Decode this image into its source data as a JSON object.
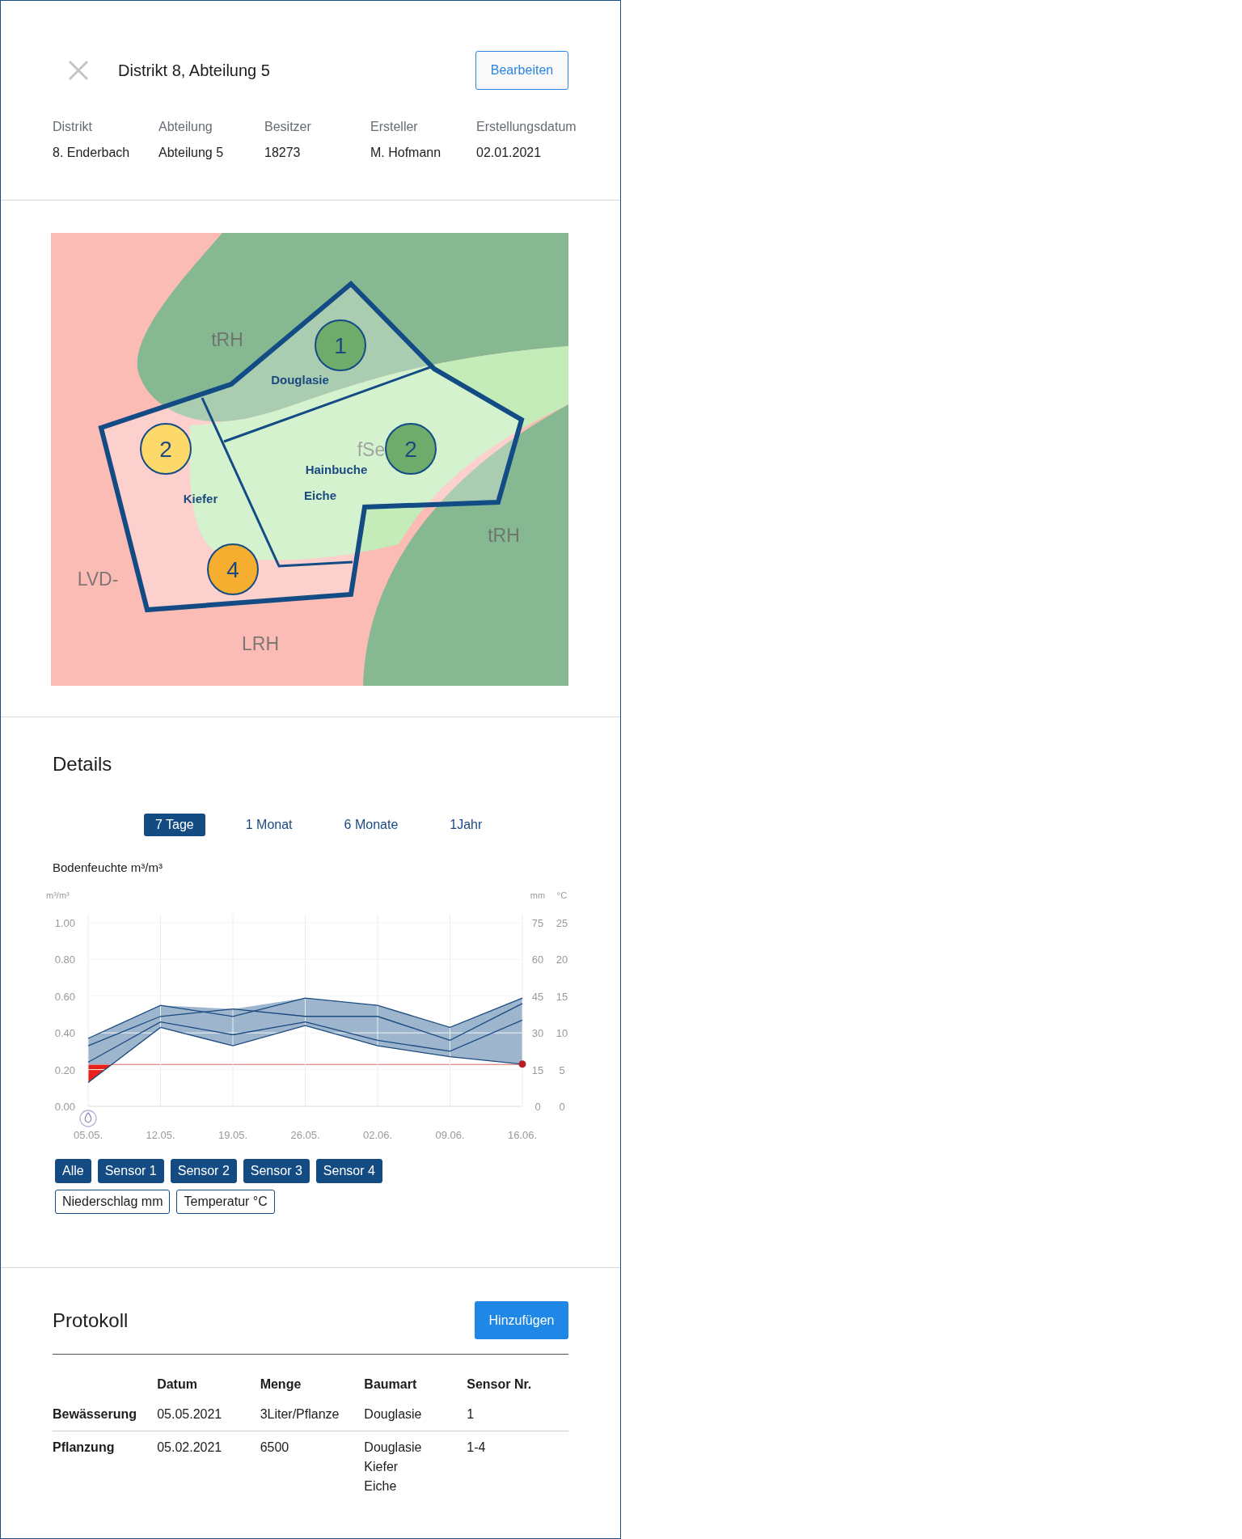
{
  "header": {
    "title": "Distrikt 8, Abteilung 5",
    "edit_button": "Bearbeiten"
  },
  "info": [
    {
      "label": "Distrikt",
      "value": "8. Enderbach"
    },
    {
      "label": "Abteilung",
      "value": "Abteilung 5"
    },
    {
      "label": "Besitzer",
      "value": "18273"
    },
    {
      "label": "Ersteller",
      "value": "M. Hofmann"
    },
    {
      "label": "Erstellungsdatum",
      "value": "02.01.2021"
    }
  ],
  "map": {
    "zone_labels": [
      "tRH",
      "fSe",
      "tRH",
      "LVD-",
      "LRH"
    ],
    "stand_labels": [
      "Douglasie",
      "Hainbuche",
      "Eiche",
      "Kiefer"
    ],
    "markers": [
      {
        "number": "1",
        "color": "#6fab6b"
      },
      {
        "number": "2",
        "color": "#fdd86b"
      },
      {
        "number": "2",
        "color": "#6fab6b"
      },
      {
        "number": "4",
        "color": "#f5ae30"
      }
    ]
  },
  "details": {
    "title": "Details",
    "ranges": [
      {
        "label": "7 Tage",
        "selected": true
      },
      {
        "label": "1 Monat",
        "selected": false
      },
      {
        "label": "6 Monate",
        "selected": false
      },
      {
        "label": "1Jahr",
        "selected": false
      }
    ],
    "chart_title": "Bodenfeuchte m³/m³",
    "right_axes": [
      {
        "unit": "mm",
        "ticks": [
          "75",
          "60",
          "45",
          "30",
          "15",
          "0"
        ]
      },
      {
        "unit": "°C",
        "ticks": [
          "25",
          "20",
          "15",
          "10",
          "5",
          "0"
        ]
      }
    ],
    "chart_data": {
      "type": "line",
      "ylabel": "m³/m³",
      "categories": [
        "05.05.",
        "12.05.",
        "19.05.",
        "26.05.",
        "02.06.",
        "09.06.",
        "16.06."
      ],
      "series": [
        {
          "color": "#1b4a80",
          "values": [
            0.37,
            0.55,
            0.49,
            0.59,
            0.55,
            0.43,
            0.59
          ]
        },
        {
          "color": "#1b4a80",
          "values": [
            0.33,
            0.49,
            0.53,
            0.49,
            0.49,
            0.36,
            0.56
          ]
        },
        {
          "color": "#1b4a80",
          "values": [
            0.24,
            0.46,
            0.39,
            0.46,
            0.36,
            0.3,
            0.47
          ]
        },
        {
          "color": "#1b4a80",
          "values": [
            0.13,
            0.43,
            0.33,
            0.44,
            0.33,
            0.27,
            0.23
          ]
        }
      ],
      "grid": true,
      "ylim": [
        0,
        1
      ],
      "yticks": [
        {
          "value": 1,
          "label": "1.00"
        },
        {
          "value": 0.8,
          "label": "0.80"
        },
        {
          "value": 0.6,
          "label": "0.60"
        },
        {
          "value": 0.4,
          "label": "0.40"
        },
        {
          "value": 0.2,
          "label": "0.20"
        },
        {
          "value": 0,
          "label": "0.00"
        }
      ]
    },
    "sensor_filters": [
      {
        "label": "Alle",
        "selected": true
      },
      {
        "label": "Sensor 1",
        "selected": true
      },
      {
        "label": "Sensor 2",
        "selected": true
      },
      {
        "label": "Sensor 3",
        "selected": true
      },
      {
        "label": "Sensor 4",
        "selected": true
      }
    ],
    "layer_toggles": [
      {
        "label": "Niederschlag mm",
        "selected": false
      },
      {
        "label": "Temperatur °C",
        "selected": false
      }
    ]
  },
  "protocol": {
    "title": "Protokoll",
    "add_button": "Hinzufügen",
    "columns": [
      "Datum",
      "Menge",
      "Baumart",
      "Sensor Nr."
    ],
    "rows": [
      {
        "type": "Bewässerung",
        "cells": [
          [
            "05.05.2021"
          ],
          [
            "3Liter/Pflanze"
          ],
          [
            "Douglasie"
          ],
          [
            "1"
          ]
        ]
      },
      {
        "type": "Pflanzung",
        "cells": [
          [
            "05.02.2021"
          ],
          [
            "6500"
          ],
          [
            "Douglasie",
            "Kiefer",
            "Eiche"
          ],
          [
            "1-4"
          ]
        ]
      }
    ]
  }
}
